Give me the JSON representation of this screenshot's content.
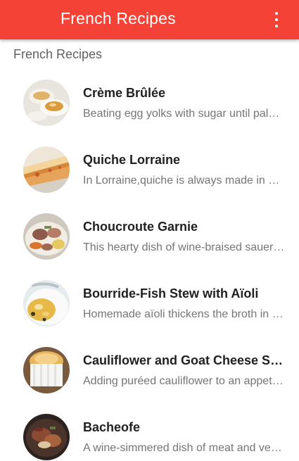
{
  "appbar": {
    "title": "French Recipes",
    "color": "#f44336",
    "menu_icon": "more-vert-icon"
  },
  "section": {
    "header": "French Recipes"
  },
  "recipes": [
    {
      "title": "Crème Brûlée",
      "description": "Beating egg yolks with sugar until pale and thick"
    },
    {
      "title": "Quiche Lorraine",
      "description": "In Lorraine,quiche is always made in a pastry shell"
    },
    {
      "title": "Choucroute Garnie",
      "description": "This hearty dish of wine-braised sauerkraut and pork"
    },
    {
      "title": "Bourride-Fish Stew with Aïoli",
      "description": "Homemade aïoli thickens the broth in this fish stew"
    },
    {
      "title": "Cauliflower and Goat Cheese Soufflé",
      "description": "Adding puréed cauliflower to an appetizer soufflé"
    },
    {
      "title": "Bacheofe",
      "description": "A wine-simmered dish of meat and vegetables"
    }
  ]
}
